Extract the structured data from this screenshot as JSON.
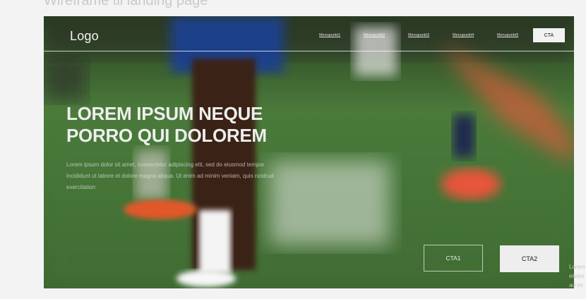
{
  "page": {
    "heading": "Wireframe til landing page"
  },
  "header": {
    "logo": "Logo",
    "nav_items": [
      "Menupunkt1",
      "Menupunkt2",
      "Menupunkt3",
      "Menupunkt4",
      "Menupunkt5"
    ],
    "cta_label": "CTA"
  },
  "hero": {
    "title_line1": "LOREM IPSUM NEQUE",
    "title_line2": "PORRO QUI DOLOREM",
    "body": "Lorem ipsum dolor sit amet, consectetur adipiscing elit, sed do eiusmod tempor incididunt ut labore et dolore magna aliqua. Ut enim ad minim veniam, quis nostrud exercitation",
    "cta1_label": "CTA1",
    "cta2_label": "CTA2"
  },
  "side_text": {
    "lines": [
      "Lorem",
      "eiusm",
      "ad mi"
    ]
  },
  "colors": {
    "grass": "#3f6a32",
    "shirt_blue": "#1f3f8a",
    "boot_orange": "#e2582c"
  },
  "icons": {
    "hero_image": "football-players-blur-image"
  }
}
